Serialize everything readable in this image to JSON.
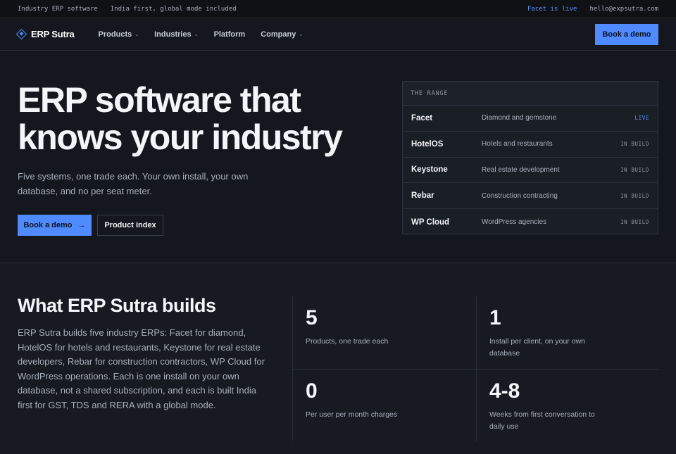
{
  "topbar": {
    "left": [
      "Industry ERP software",
      "India first, global mode included"
    ],
    "live_link": "Facet is live",
    "email": "hello@expsutra.com"
  },
  "nav": {
    "brand": "ERP Sutra",
    "items": [
      {
        "label": "Products",
        "dropdown": true
      },
      {
        "label": "Industries",
        "dropdown": true
      },
      {
        "label": "Platform",
        "dropdown": false
      },
      {
        "label": "Company",
        "dropdown": true
      }
    ],
    "cta": "Book a demo"
  },
  "hero": {
    "title_line1": "ERP software that",
    "title_line2": "knows your industry",
    "subtitle": "Five systems, one trade each. Your own install, your own database, and no per seat meter.",
    "primary_button": "Book a demo",
    "secondary_button": "Product index"
  },
  "range": {
    "heading": "THE RANGE",
    "rows": [
      {
        "name": "Facet",
        "desc": "Diamond and gemstone",
        "status": "LIVE"
      },
      {
        "name": "HotelOS",
        "desc": "Hotels and restaurants",
        "status": "IN BUILD"
      },
      {
        "name": "Keystone",
        "desc": "Real estate development",
        "status": "IN BUILD"
      },
      {
        "name": "Rebar",
        "desc": "Construction contracting",
        "status": "IN BUILD"
      },
      {
        "name": "WP Cloud",
        "desc": "WordPress agencies",
        "status": "IN BUILD"
      }
    ]
  },
  "builds": {
    "title": "What ERP Sutra builds",
    "body": "ERP Sutra builds five industry ERPs: Facet for diamond, HotelOS for hotels and restaurants, Keystone for real estate developers, Rebar for construction contractors, WP Cloud for WordPress operations. Each is one install on your own database, not a shared subscription, and each is built India first for GST, TDS and RERA with a global mode."
  },
  "stats": [
    {
      "value": "5",
      "label": "Products, one trade each"
    },
    {
      "value": "1",
      "label": "Install per client, on your own database"
    },
    {
      "value": "0",
      "label": "Per user per month charges"
    },
    {
      "value": "4-8",
      "label": "Weeks from first conversation to daily use"
    }
  ],
  "colors": {
    "accent": "#4f8bff",
    "background": "#14171d"
  }
}
